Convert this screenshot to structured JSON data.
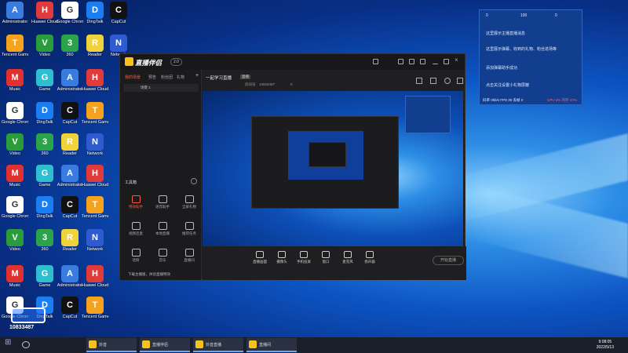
{
  "desktop": {
    "icons": [
      {
        "label": "Administrator",
        "color": "#3a7be0",
        "glyph": "A"
      },
      {
        "label": "Huawei Cloud",
        "color": "#e03a3a",
        "glyph": "H"
      },
      {
        "label": "Google Chrome",
        "color": "#ffffff",
        "glyph": "G"
      },
      {
        "label": "DingTalk",
        "color": "#1a7df0",
        "glyph": "D"
      },
      {
        "label": "CapCut",
        "color": "#111111",
        "glyph": "C"
      },
      {
        "label": "Tencent Games",
        "color": "#f7a21c",
        "glyph": "T"
      },
      {
        "label": "Video",
        "color": "#2b9c3b",
        "glyph": "V"
      },
      {
        "label": "360",
        "color": "#2aa34b",
        "glyph": "3"
      },
      {
        "label": "Reader",
        "color": "#f0d23a",
        "glyph": "R"
      },
      {
        "label": "Network",
        "color": "#2f5bd0",
        "glyph": "N"
      },
      {
        "label": "Music",
        "color": "#e03030",
        "glyph": "M"
      },
      {
        "label": "Game",
        "color": "#2dbfd0",
        "glyph": "G"
      }
    ],
    "watermark_text": "10833487"
  },
  "app": {
    "brand": "直播伴侣",
    "version": "2.0",
    "sidebar_tabs": [
      "我的场景",
      "预告",
      "粉丝团",
      "礼物"
    ],
    "scene_label": "场景 1",
    "tools_title": "工具箱",
    "tools": [
      "特效助手",
      "语音助手",
      "全屏礼物",
      "视频连麦",
      "本地直播",
      "推荐任务",
      "话筒",
      "音乐",
      "直播间"
    ],
    "stream_title": "一起学习直播",
    "stream_tag": "直播",
    "stream_room_label": "房间号",
    "stream_room_id": "10833487",
    "stream_likes": "0",
    "bottom_buttons": [
      "直播画面",
      "摄像头",
      "手机投屏",
      "窗口",
      "麦克风",
      "扬声器"
    ],
    "start_button": "开始直播",
    "footer_note": "下载主播版，体验直播特效"
  },
  "panel": {
    "stats": [
      "0",
      "100",
      "0"
    ],
    "messages": [
      "这里展示主播直播消息",
      "这里展示弹幕、收到的礼物、粉丝进场等",
      "添加弹幕助手成功",
      "点击关注设置小礼物屏蔽"
    ],
    "status_left": "码率 0kb/s  FPS 30  丢帧 0",
    "status_right": "CPU 2%  内存 17%"
  },
  "taskbar": {
    "tasks": [
      "抖音",
      "直播伴侣",
      "抖音直播",
      "直播间"
    ],
    "time": "9:08:05",
    "date": "2022/5/13"
  }
}
